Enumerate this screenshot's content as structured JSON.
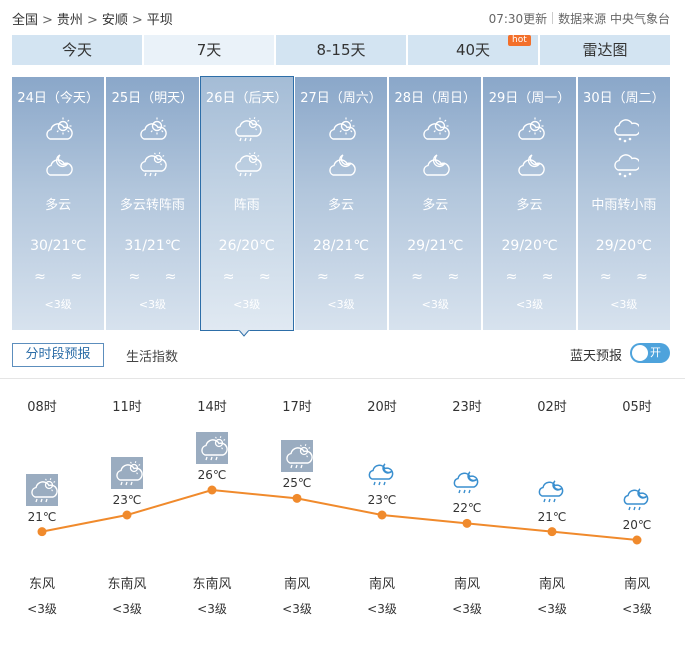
{
  "breadcrumb": [
    {
      "label": "全国"
    },
    {
      "label": "贵州"
    },
    {
      "label": "安顺"
    },
    {
      "label": "平坝"
    }
  ],
  "meta": {
    "update": "07:30更新",
    "source": "数据来源 中央气象台"
  },
  "tabs": [
    {
      "label": "今天"
    },
    {
      "label": "7天"
    },
    {
      "label": "8-15天"
    },
    {
      "label": "40天",
      "badge": "hot"
    },
    {
      "label": "雷达图"
    }
  ],
  "days": [
    {
      "date": "24日（今天）",
      "icon_day": "partly-cloudy-icon",
      "icon_night": "cloudy-night-icon",
      "desc": "多云",
      "temp": "30/21℃",
      "wind": "≈ ≈",
      "level": "<3级"
    },
    {
      "date": "25日（明天）",
      "icon_day": "partly-cloudy-icon",
      "icon_night": "shower-icon",
      "desc": "多云转阵雨",
      "temp": "31/21℃",
      "wind": "≈ ≈",
      "level": "<3级"
    },
    {
      "date": "26日（后天）",
      "icon_day": "shower-icon",
      "icon_night": "shower-icon",
      "desc": "阵雨",
      "temp": "26/20℃",
      "wind": "≈ ≈",
      "level": "<3级"
    },
    {
      "date": "27日（周六）",
      "icon_day": "partly-cloudy-icon",
      "icon_night": "cloudy-night-icon",
      "desc": "多云",
      "temp": "28/21℃",
      "wind": "≈ ≈",
      "level": "<3级"
    },
    {
      "date": "28日（周日）",
      "icon_day": "partly-cloudy-icon",
      "icon_night": "cloudy-night-icon",
      "desc": "多云",
      "temp": "29/21℃",
      "wind": "≈ ≈",
      "level": "<3级"
    },
    {
      "date": "29日（周一）",
      "icon_day": "partly-cloudy-icon",
      "icon_night": "cloudy-night-icon",
      "desc": "多云",
      "temp": "29/20℃",
      "wind": "≈ ≈",
      "level": "<3级"
    },
    {
      "date": "30日（周二）",
      "icon_day": "rain-icon",
      "icon_night": "rain-icon",
      "desc": "中雨转小雨",
      "temp": "29/20℃",
      "wind": "≈ ≈",
      "level": "<3级"
    }
  ],
  "subtabs": {
    "hourly": "分时段预报",
    "life": "生活指数",
    "bluesky": "蓝天预报",
    "toggle": "开"
  },
  "chart_data": {
    "type": "line",
    "x": [
      "08时",
      "11时",
      "14时",
      "17时",
      "20时",
      "23时",
      "02时",
      "05时"
    ],
    "values": [
      21,
      23,
      26,
      25,
      23,
      22,
      21,
      20
    ],
    "labels": [
      "21℃",
      "23℃",
      "26℃",
      "25℃",
      "23℃",
      "22℃",
      "21℃",
      "20℃"
    ],
    "icons": [
      "shower-day-icon",
      "shower-day-icon",
      "shower-day-icon",
      "shower-day-icon",
      "shower-night-icon",
      "shower-night-icon",
      "shower-night-icon",
      "shower-night-icon"
    ],
    "wind_dir": [
      "东风",
      "东南风",
      "东南风",
      "南风",
      "南风",
      "南风",
      "南风",
      "南风"
    ],
    "wind_level": [
      "<3级",
      "<3级",
      "<3级",
      "<3级",
      "<3级",
      "<3级",
      "<3级",
      "<3级"
    ],
    "ylim": [
      20,
      26
    ],
    "line_color": "#f08a2c"
  }
}
